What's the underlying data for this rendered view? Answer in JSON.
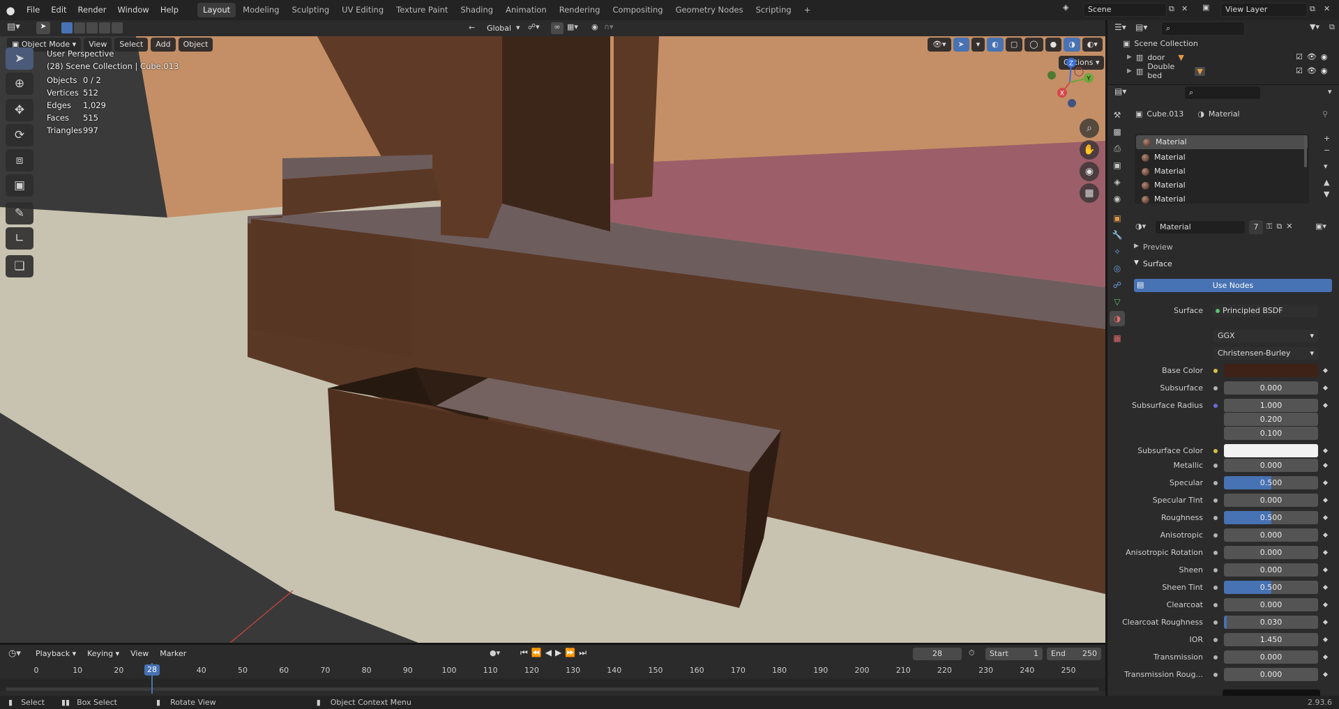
{
  "app": {
    "version": "2.93.6"
  },
  "menus": [
    "File",
    "Edit",
    "Render",
    "Window",
    "Help"
  ],
  "workspaces": [
    "Layout",
    "Modeling",
    "Sculpting",
    "UV Editing",
    "Texture Paint",
    "Shading",
    "Animation",
    "Rendering",
    "Compositing",
    "Geometry Nodes",
    "Scripting"
  ],
  "active_workspace": "Layout",
  "scene": {
    "name": "Scene",
    "view_layer": "View Layer"
  },
  "viewport": {
    "mode": "Object Mode",
    "header_menus": [
      "View",
      "Select",
      "Add",
      "Object"
    ],
    "transform_orientation": "Global",
    "options_label": "Options",
    "perspective_label": "User Perspective",
    "collection_label": "(28) Scene Collection | Cube.013",
    "stats": [
      {
        "label": "Objects",
        "value": "0 / 2"
      },
      {
        "label": "Vertices",
        "value": "512"
      },
      {
        "label": "Edges",
        "value": "1,029"
      },
      {
        "label": "Faces",
        "value": "515"
      },
      {
        "label": "Triangles",
        "value": "997"
      }
    ],
    "gizmo": {
      "x": "X",
      "y": "Y",
      "z": "Z"
    }
  },
  "outliner": {
    "root": "Scene Collection",
    "items": [
      {
        "name": "door"
      },
      {
        "name": "Double bed"
      }
    ]
  },
  "properties": {
    "object_name": "Cube.013",
    "material_tab": "Material",
    "slots": [
      "Material",
      "Material",
      "Material",
      "Material",
      "Material"
    ],
    "material_name": "Material",
    "users": "7",
    "preview_label": "Preview",
    "surface_label": "Surface",
    "use_nodes_label": "Use Nodes",
    "surface_field_label": "Surface",
    "surface_shader": "Principled BSDF",
    "distribution": "GGX",
    "subsurface_method": "Christensen-Burley",
    "base_color_label": "Base Color",
    "base_color": "#3f2217",
    "subsurface_label": "Subsurface",
    "subsurface": "0.000",
    "subsurface_radius_label": "Subsurface Radius",
    "subsurface_radius": [
      "1.000",
      "0.200",
      "0.100"
    ],
    "subsurface_color_label": "Subsurface Color",
    "subsurface_color": "#f2f2f2",
    "params": [
      {
        "label": "Metallic",
        "value": "0.000",
        "fraction": 0
      },
      {
        "label": "Specular",
        "value": "0.500",
        "fraction": 0.5
      },
      {
        "label": "Specular Tint",
        "value": "0.000",
        "fraction": 0
      },
      {
        "label": "Roughness",
        "value": "0.500",
        "fraction": 0.5
      },
      {
        "label": "Anisotropic",
        "value": "0.000",
        "fraction": 0
      },
      {
        "label": "Anisotropic Rotation",
        "value": "0.000",
        "fraction": 0
      },
      {
        "label": "Sheen",
        "value": "0.000",
        "fraction": 0
      },
      {
        "label": "Sheen Tint",
        "value": "0.500",
        "fraction": 0.5
      },
      {
        "label": "Clearcoat",
        "value": "0.000",
        "fraction": 0
      },
      {
        "label": "Clearcoat Roughness",
        "value": "0.030",
        "fraction": 0.03
      },
      {
        "label": "IOR",
        "value": "1.450",
        "fraction": 0
      },
      {
        "label": "Transmission",
        "value": "0.000",
        "fraction": 0
      },
      {
        "label": "Transmission Roug...",
        "value": "0.000",
        "fraction": 0
      }
    ]
  },
  "timeline": {
    "menus": [
      "Playback",
      "Keying",
      "View",
      "Marker"
    ],
    "current_frame": "28",
    "start_label": "Start",
    "start": "1",
    "end_label": "End",
    "end": "250",
    "ticks": [
      "0",
      "10",
      "20",
      "40",
      "50",
      "60",
      "70",
      "80",
      "90",
      "100",
      "110",
      "120",
      "130",
      "140",
      "150",
      "160",
      "170",
      "180",
      "190",
      "200",
      "210",
      "220",
      "230",
      "240",
      "250"
    ]
  },
  "status": {
    "select": "Select",
    "box_select": "Box Select",
    "rotate": "Rotate View",
    "context": "Object Context Menu"
  },
  "colors": {
    "accent": "#4772b3",
    "header": "#232323",
    "panel": "#2b2b2b"
  }
}
